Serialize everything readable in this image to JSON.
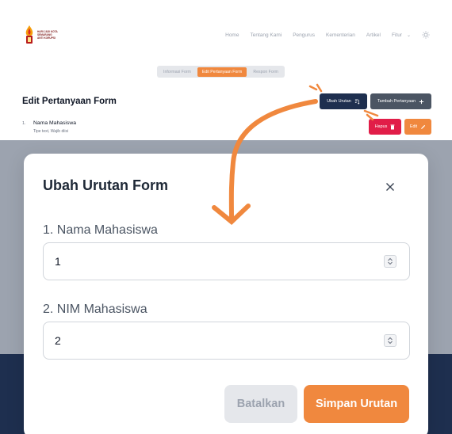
{
  "colors": {
    "accent_orange": "#f0883e",
    "navy": "#1e2f4f",
    "danger": "#e11d48",
    "overlay_gray": "#9ca3af"
  },
  "navbar": {
    "logo_icon": "torch-flame-logo",
    "logo_lines": [
      "HARI JADI KOTA",
      "SEMARANG",
      "ANTI KORUPSI"
    ],
    "links": [
      "Home",
      "Tentang Kami",
      "Pengurus",
      "Kementerian",
      "Artikel"
    ],
    "fitur_label": "Fitur",
    "theme_icon": "sun-icon"
  },
  "tabs": [
    {
      "label": "Informasi Form",
      "active": false
    },
    {
      "label": "Edit Pertanyaan Form",
      "active": true
    },
    {
      "label": "Respon Form",
      "active": false
    }
  ],
  "page": {
    "title": "Edit Pertanyaan Form",
    "ubah_urutan_label": "Ubah Urutan",
    "tambah_pertanyaan_label": "Tambah Pertanyaan",
    "question": {
      "number": "1.",
      "name": "Nama Mahasiswa",
      "subtitle": "Tipe text, Wajib diisi"
    },
    "hapus_label": "Hapus",
    "edit_label": "Edit"
  },
  "modal": {
    "title": "Ubah Urutan Form",
    "fields": [
      {
        "label": "1. Nama Mahasiswa",
        "value": "1"
      },
      {
        "label": "2. NIM Mahasiswa",
        "value": "2"
      }
    ],
    "cancel_label": "Batalkan",
    "save_label": "Simpan Urutan"
  }
}
